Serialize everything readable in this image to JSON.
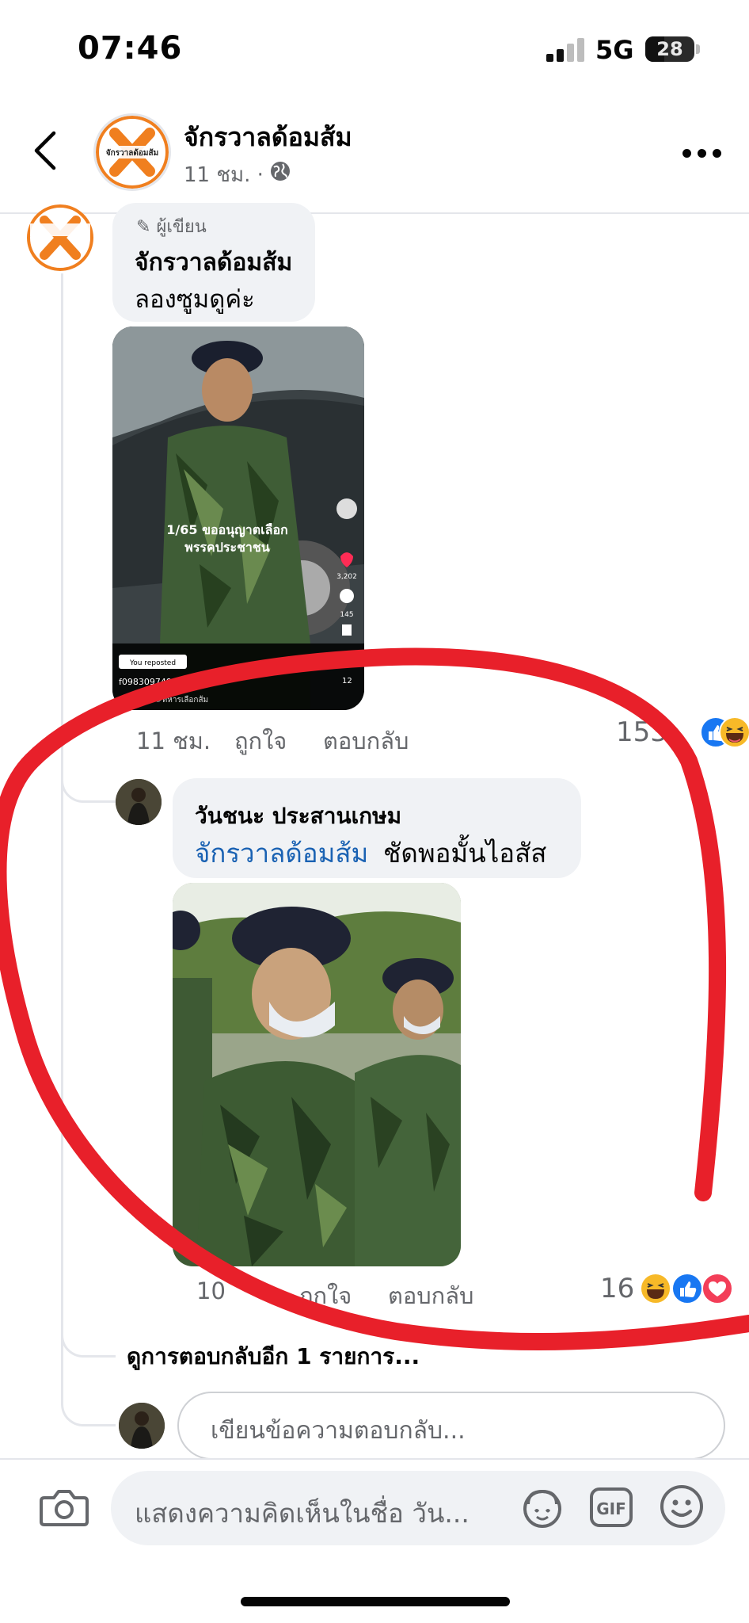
{
  "status_bar": {
    "time": "07:46",
    "network": "5G",
    "battery": "28"
  },
  "header": {
    "page_name": "จักรวาลด้อมส้ม",
    "time_ago": "11 ชม.",
    "separator": "·"
  },
  "logo": {
    "text": "จักรวาลด้อมส้ม"
  },
  "comment_main": {
    "badge": "ผู้เขียน",
    "author": "จักรวาลด้อมส้ม",
    "text": "ลองซูมดูค่ะ",
    "time": "11 ชม.",
    "like_label": "ถูกใจ",
    "reply_label": "ตอบกลับ",
    "reaction_count": "153",
    "image_overlay": {
      "caption_line1": "1/65 ขออนุญาตเลือก",
      "caption_line2": "พรรคประชาชน",
      "likes": "3,202",
      "comments": "145",
      "reposted": "You reposted",
      "username": "f0983097499ch",
      "hashtags": "ประชาชน #ทหารเลือกส้ม",
      "count": "12"
    }
  },
  "comment_reply": {
    "author": "วันชนะ ประสานเกษม",
    "mention": "จักรวาลด้อมส้ม",
    "text": "ชัดพอมั้นไอสัส",
    "time": "10",
    "like_label": "ถูกใจ",
    "reply_label": "ตอบกลับ",
    "reaction_count": "16"
  },
  "more_replies": "ดูการตอบกลับอีก 1 รายการ...",
  "reply_input": {
    "placeholder": "เขียนข้อความตอบกลับ..."
  },
  "comment_input": {
    "placeholder": "แสดงความคิดเห็นในชื่อ วัน..."
  },
  "toolbar": {
    "gif_label": "GIF"
  },
  "colors": {
    "accent": "#1877f2",
    "mention": "#1a62b3",
    "annotation": "#e8202a",
    "brand_orange": "#f07f1f"
  }
}
